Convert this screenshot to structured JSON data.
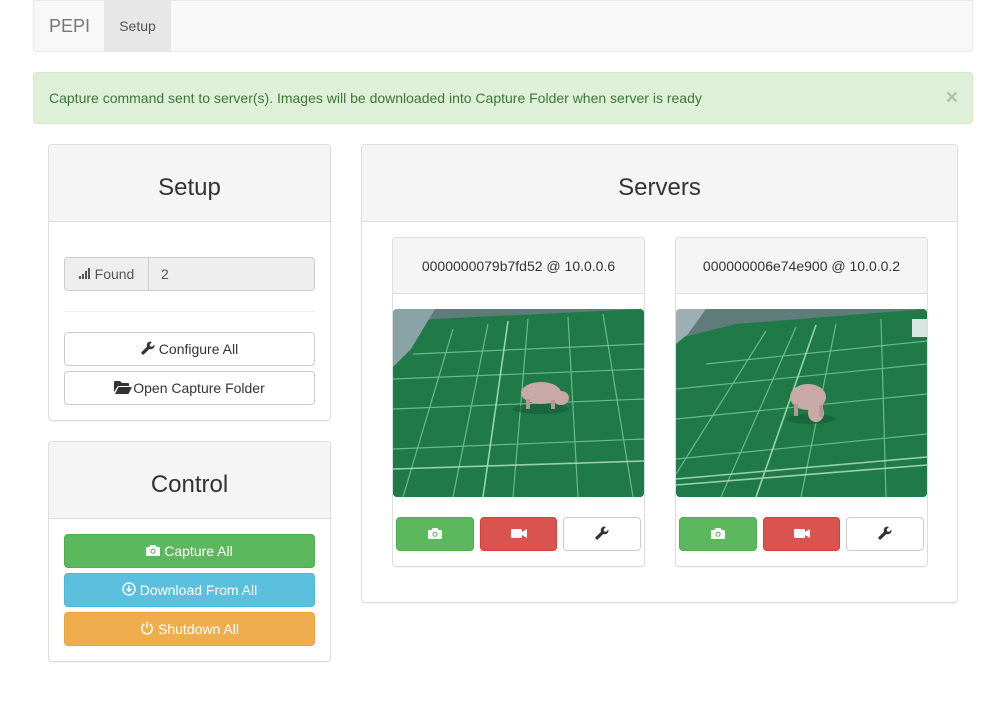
{
  "navbar": {
    "brand": "PEPI",
    "tabs": [
      {
        "label": "Setup"
      }
    ]
  },
  "alert": {
    "message": "Capture command sent to server(s). Images will be downloaded into Capture Folder when server is ready",
    "close": "×"
  },
  "setup_panel": {
    "title": "Setup",
    "found_label": "Found",
    "found_value": "2",
    "configure_label": "Configure All",
    "open_folder_label": "Open Capture Folder"
  },
  "control_panel": {
    "title": "Control",
    "capture_label": "Capture All",
    "download_label": "Download From All",
    "shutdown_label": "Shutdown All"
  },
  "servers_panel": {
    "title": "Servers",
    "servers": [
      {
        "name": "0000000079b7fd52 @ 10.0.0.6"
      },
      {
        "name": "000000006e74e900 @ 10.0.0.2"
      }
    ]
  },
  "colors": {
    "success": "#5cb85c",
    "info": "#5bc0de",
    "warning": "#f0ad4e",
    "danger": "#d9534f",
    "alert_bg": "#dff0d8",
    "alert_text": "#3c763d"
  },
  "icons": [
    "signal-icon",
    "wrench-icon",
    "folder-open-icon",
    "camera-icon",
    "download-icon",
    "power-icon",
    "video-camera-icon"
  ]
}
